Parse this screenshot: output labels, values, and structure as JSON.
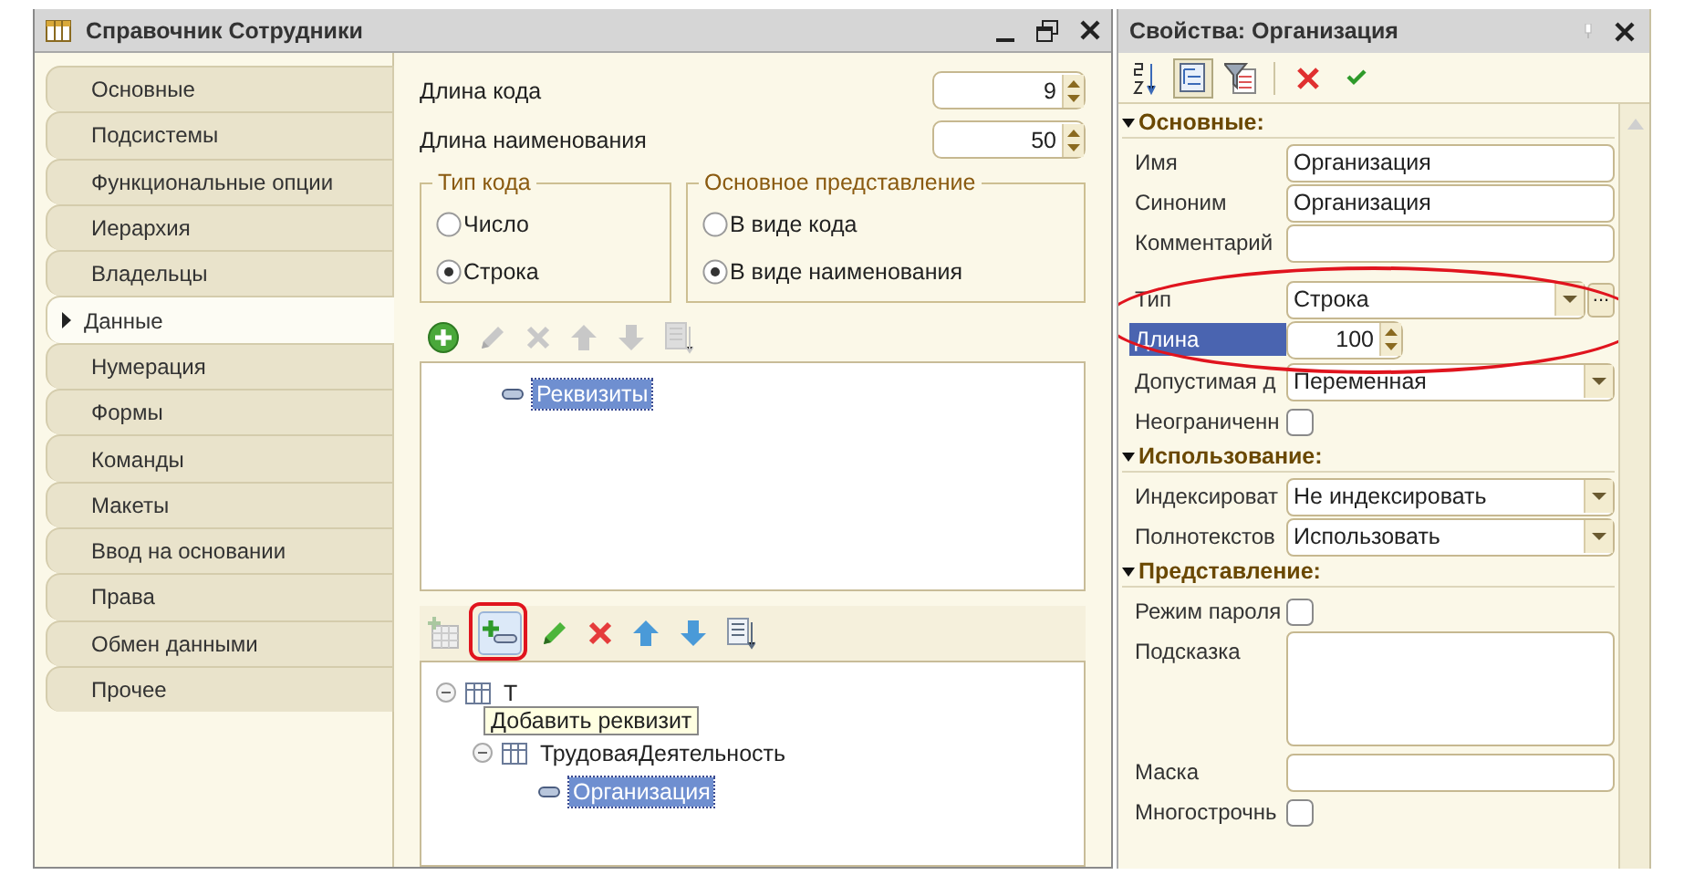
{
  "window": {
    "title": "Справочник Сотрудники"
  },
  "tabs": [
    {
      "label": "Основные",
      "selected": false
    },
    {
      "label": "Подсистемы",
      "selected": false
    },
    {
      "label": "Функциональные опции",
      "selected": false
    },
    {
      "label": "Иерархия",
      "selected": false
    },
    {
      "label": "Владельцы",
      "selected": false
    },
    {
      "label": "Данные",
      "selected": true
    },
    {
      "label": "Нумерация",
      "selected": false
    },
    {
      "label": "Формы",
      "selected": false
    },
    {
      "label": "Команды",
      "selected": false
    },
    {
      "label": "Макеты",
      "selected": false
    },
    {
      "label": "Ввод на основании",
      "selected": false
    },
    {
      "label": "Права",
      "selected": false
    },
    {
      "label": "Обмен данными",
      "selected": false
    },
    {
      "label": "Прочее",
      "selected": false
    }
  ],
  "lengths": [
    {
      "label": "Длина кода",
      "value": "9"
    },
    {
      "label": "Длина наименования",
      "value": "50"
    }
  ],
  "groups": [
    {
      "title": "Тип кода",
      "options": [
        {
          "label": "Число",
          "selected": false
        },
        {
          "label": "Строка",
          "selected": true
        }
      ]
    },
    {
      "title": "Основное представление",
      "options": [
        {
          "label": "В виде кода",
          "selected": false
        },
        {
          "label": "В виде наименования",
          "selected": true
        }
      ]
    }
  ],
  "top_toolbar": [
    {
      "kind": "add",
      "disabled": false
    },
    {
      "kind": "edit",
      "disabled": true
    },
    {
      "kind": "delete",
      "disabled": true
    },
    {
      "kind": "up",
      "disabled": true
    },
    {
      "kind": "down",
      "disabled": true
    },
    {
      "kind": "list",
      "disabled": true
    }
  ],
  "top_tree": [
    {
      "kind": "attribute",
      "label": "Реквизиты",
      "selected": true
    }
  ],
  "bottom_toolbar": [
    {
      "kind": "table-add",
      "disabled": true,
      "circled": false
    },
    {
      "kind": "attribute-add",
      "disabled": false,
      "circled": true
    },
    {
      "kind": "edit",
      "disabled": false,
      "circled": false
    },
    {
      "kind": "delete",
      "disabled": false,
      "circled": false
    },
    {
      "kind": "up",
      "disabled": false,
      "circled": false
    },
    {
      "kind": "down",
      "disabled": false,
      "circled": false
    },
    {
      "kind": "list",
      "disabled": false,
      "circled": false
    }
  ],
  "bottom_tree": [
    {
      "kind": "table",
      "label": "Т",
      "expanded": true,
      "selected": false,
      "children": [
        {
          "kind": "table",
          "label": "ТрудоваяДеятельность",
          "expanded": true,
          "selected": false,
          "children": [
            {
              "kind": "attribute",
              "label": "Организация",
              "selected": true
            }
          ]
        }
      ]
    }
  ],
  "tooltip": "Добавить реквизит",
  "properties": {
    "title": "Свойства: Организация",
    "toolbar": [
      {
        "kind": "sort",
        "selected": false
      },
      {
        "kind": "tree",
        "selected": true
      },
      {
        "kind": "filter",
        "selected": false
      },
      {
        "kind": "cancel",
        "selected": false
      },
      {
        "kind": "ok",
        "selected": false
      }
    ],
    "sections": [
      {
        "title": "Основные:",
        "expanded": true,
        "rows": [
          {
            "kind": "text",
            "label": "Имя",
            "value": "Организация",
            "circled": false,
            "selected": false
          },
          {
            "kind": "text",
            "label": "Синоним",
            "value": "Организация",
            "circled": false,
            "selected": false
          },
          {
            "kind": "text",
            "label": "Комментарий",
            "circled": false,
            "selected": false
          },
          {
            "kind": "select",
            "label": "Тип",
            "value": "Строка",
            "more": "...",
            "circled": true,
            "selected": false
          },
          {
            "kind": "number",
            "label": "Длина",
            "value": "100",
            "circled": true,
            "selected": true
          },
          {
            "kind": "select",
            "label": "Допустимая д",
            "value": "Переменная",
            "circled": false,
            "selected": false
          },
          {
            "kind": "check",
            "label": "Неограниченн",
            "checked": false,
            "circled": false,
            "selected": false
          }
        ]
      },
      {
        "title": "Использование:",
        "expanded": true,
        "rows": [
          {
            "kind": "select",
            "label": "Индексироват",
            "value": "Не индексировать",
            "circled": false,
            "selected": false
          },
          {
            "kind": "select",
            "label": "Полнотекстов",
            "value": "Использовать",
            "circled": false,
            "selected": false
          }
        ]
      },
      {
        "title": "Представление:",
        "expanded": true,
        "rows": [
          {
            "kind": "check",
            "label": "Режим пароля",
            "checked": false,
            "circled": false,
            "selected": false
          },
          {
            "kind": "memo",
            "label": "Подсказка",
            "circled": false,
            "selected": false
          },
          {
            "kind": "text",
            "label": "Маска",
            "circled": false,
            "selected": false
          },
          {
            "kind": "check",
            "label": "Многострочнь",
            "checked": false,
            "circled": false,
            "selected": false
          }
        ]
      }
    ]
  }
}
